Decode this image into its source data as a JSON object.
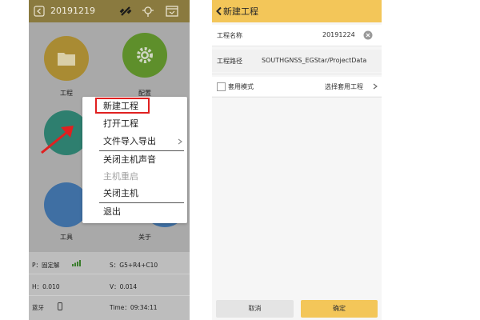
{
  "left": {
    "header": {
      "date": "20191219"
    },
    "apps": {
      "project_label": "工程",
      "config_label": "配置",
      "tools_label": "工具",
      "about_label": "关于"
    },
    "menu": {
      "new_project": "新建工程",
      "open_project": "打开工程",
      "file_import_export": "文件导入导出",
      "mute_receiver": "关闭主机声音",
      "restart_receiver": "主机重启",
      "shutdown_receiver": "关闭主机",
      "exit": "退出"
    },
    "status": {
      "p": "P：固定解",
      "s": "S：G5+R4+C10",
      "h": "H：0.010",
      "v": "V：0.014",
      "bt": "蓝牙",
      "time": "Time：09:34:11"
    }
  },
  "right": {
    "header": {
      "title": "新建工程"
    },
    "project_name_label": "工程名称",
    "project_name_value": "20191224",
    "project_path_label": "工程路径",
    "project_path_value": "SOUTHGNSS_EGStar/ProjectData",
    "template_mode_label": "套用模式",
    "select_template_label": "选择套用工程",
    "cancel_label": "取消",
    "confirm_label": "确定"
  },
  "colors": {
    "left_header": "#8a7a3f",
    "right_header": "#f3c659",
    "highlight_red": "#e02020",
    "confirm_button": "#f3c659"
  }
}
